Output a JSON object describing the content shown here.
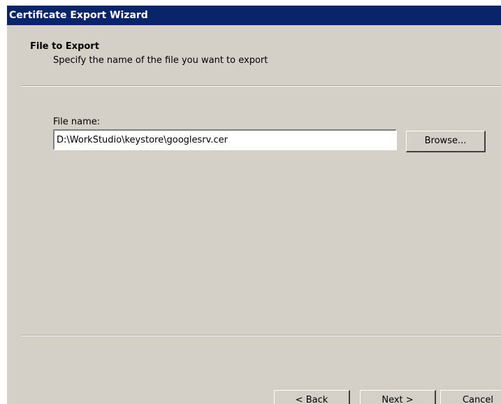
{
  "window": {
    "title": "Certificate Export Wizard"
  },
  "header": {
    "title": "File to Export",
    "subtitle": "Specify the name of the file you want to export"
  },
  "form": {
    "file_name_label": "File name:",
    "file_name_value": "D:\\WorkStudio\\keystore\\googlesrv.cer",
    "browse_label": "Browse..."
  },
  "footer": {
    "back_label": "< Back",
    "next_label": "Next >",
    "cancel_label": "Cancel"
  },
  "colors": {
    "title_bar": "#0a246a",
    "dialog_face": "#d4d0c8"
  }
}
